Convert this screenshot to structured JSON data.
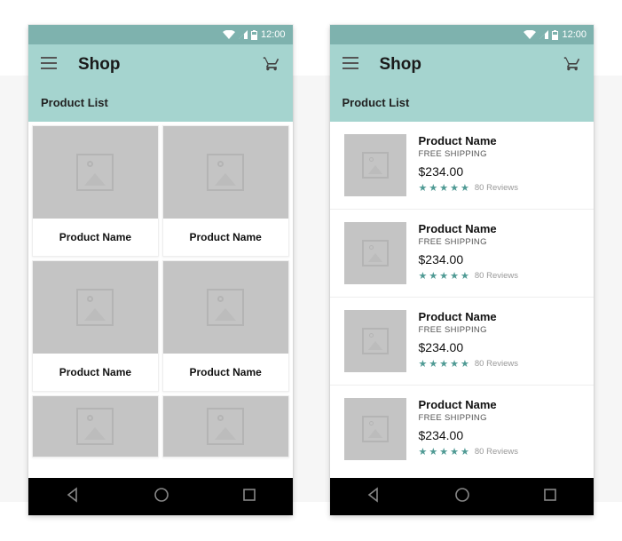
{
  "status": {
    "time": "12:00"
  },
  "app": {
    "title": "Shop",
    "subtitle": "Product List"
  },
  "grid_phone": {
    "items": [
      {
        "name": "Product Name"
      },
      {
        "name": "Product Name"
      },
      {
        "name": "Product Name"
      },
      {
        "name": "Product Name"
      }
    ]
  },
  "list_phone": {
    "items": [
      {
        "name": "Product Name",
        "shipping": "FREE SHIPPING",
        "price": "$234.00",
        "stars": 5,
        "reviews": "80 Reviews"
      },
      {
        "name": "Product Name",
        "shipping": "FREE SHIPPING",
        "price": "$234.00",
        "stars": 5,
        "reviews": "80 Reviews"
      },
      {
        "name": "Product Name",
        "shipping": "FREE SHIPPING",
        "price": "$234.00",
        "stars": 5,
        "reviews": "80 Reviews"
      },
      {
        "name": "Product Name",
        "shipping": "FREE SHIPPING",
        "price": "$234.00",
        "stars": 5,
        "reviews": "80 Reviews"
      }
    ]
  },
  "colors": {
    "header": "#a5d4cf",
    "statusbar": "#7eb2ae",
    "accent": "#4f9a94",
    "placeholder": "#c4c4c4"
  }
}
